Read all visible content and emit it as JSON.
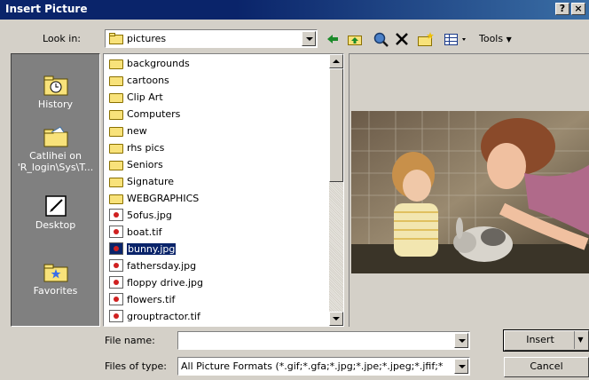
{
  "window": {
    "title": "Insert Picture",
    "help_label": "?",
    "close_label": "×"
  },
  "toolbar": {
    "lookin_label": "Look in:",
    "lookin_value": "pictures",
    "tools_label": "Tools",
    "icons": [
      "back-arrow-icon",
      "up-folder-icon",
      "search-web-icon",
      "delete-icon",
      "new-folder-icon",
      "views-icon"
    ]
  },
  "places": [
    {
      "label": "History",
      "icon": "history-icon"
    },
    {
      "label": "Catlihei on 'R_login\\Sys\\T...",
      "icon": "network-folder-icon"
    },
    {
      "label": "Desktop",
      "icon": "desktop-icon"
    },
    {
      "label": "Favorites",
      "icon": "favorites-icon"
    }
  ],
  "files": [
    {
      "name": "backgrounds",
      "type": "folder"
    },
    {
      "name": "cartoons",
      "type": "folder"
    },
    {
      "name": "Clip Art",
      "type": "folder"
    },
    {
      "name": "Computers",
      "type": "folder"
    },
    {
      "name": "new",
      "type": "folder"
    },
    {
      "name": "rhs pics",
      "type": "folder"
    },
    {
      "name": "Seniors",
      "type": "folder"
    },
    {
      "name": "Signature",
      "type": "folder"
    },
    {
      "name": "WEBGRAPHICS",
      "type": "folder"
    },
    {
      "name": "5ofus.jpg",
      "type": "image"
    },
    {
      "name": "boat.tif",
      "type": "image"
    },
    {
      "name": "bunny.jpg",
      "type": "image",
      "selected": true
    },
    {
      "name": "fathersday.jpg",
      "type": "image"
    },
    {
      "name": "floppy drive.jpg",
      "type": "image"
    },
    {
      "name": "flowers.tif",
      "type": "image"
    },
    {
      "name": "grouptractor.tif",
      "type": "image"
    }
  ],
  "bottom": {
    "filename_label": "File name:",
    "filename_value": "",
    "filetype_label": "Files of type:",
    "filetype_value": "All Picture Formats (*.gif;*.gfa;*.jpg;*.jpe;*.jpeg;*.jfif;*",
    "insert_label": "Insert",
    "cancel_label": "Cancel"
  },
  "colors": {
    "title_bar": "#0a246a",
    "face": "#d4d0c8",
    "places_bg": "#808080",
    "selection": "#0a246a"
  }
}
